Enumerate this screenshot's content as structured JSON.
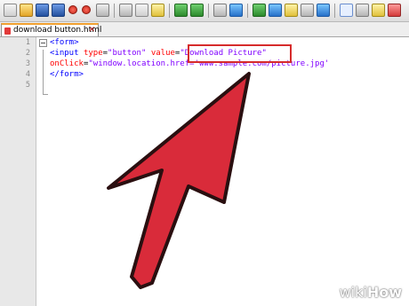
{
  "toolbar": {
    "buttons": [
      "new-file",
      "open-folder",
      "save",
      "save-all",
      "close",
      "close-all",
      "print",
      "cut",
      "copy",
      "paste",
      "undo",
      "redo",
      "find",
      "replace",
      "zoom-in",
      "zoom-out",
      "sync-scroll",
      "word-wrap",
      "show-all-chars",
      "indent-guide",
      "macro-record",
      "macro-stop",
      "macro-play"
    ]
  },
  "tabs": [
    {
      "label": "download button.html",
      "active": true
    }
  ],
  "editor": {
    "line_numbers": [
      "1",
      "2",
      "3",
      "4",
      "5"
    ],
    "lines": [
      {
        "parts": [
          [
            "tag",
            "<form>"
          ]
        ]
      },
      {
        "parts": [
          [
            "tag",
            "<input "
          ],
          [
            "attr",
            "type"
          ],
          [
            "plain",
            "="
          ],
          [
            "str",
            "\"button\""
          ],
          [
            "plain",
            " "
          ],
          [
            "attr",
            "value"
          ],
          [
            "plain",
            "="
          ],
          [
            "str",
            "\"Download Picture\""
          ]
        ]
      },
      {
        "parts": [
          [
            "attr",
            "onClick"
          ],
          [
            "plain",
            "="
          ],
          [
            "str",
            "\"window.location.href='www.sample.com/picture.jpg'"
          ]
        ]
      },
      {
        "parts": [
          [
            "tag",
            "</form>"
          ]
        ]
      },
      {
        "parts": []
      }
    ],
    "highlighted_text": "\"Download Picture\""
  },
  "annotation": {
    "arrow_color": "#d92b3a",
    "box_color": "#d62b2b"
  },
  "watermark": {
    "wiki": "wiki",
    "how": "How"
  }
}
